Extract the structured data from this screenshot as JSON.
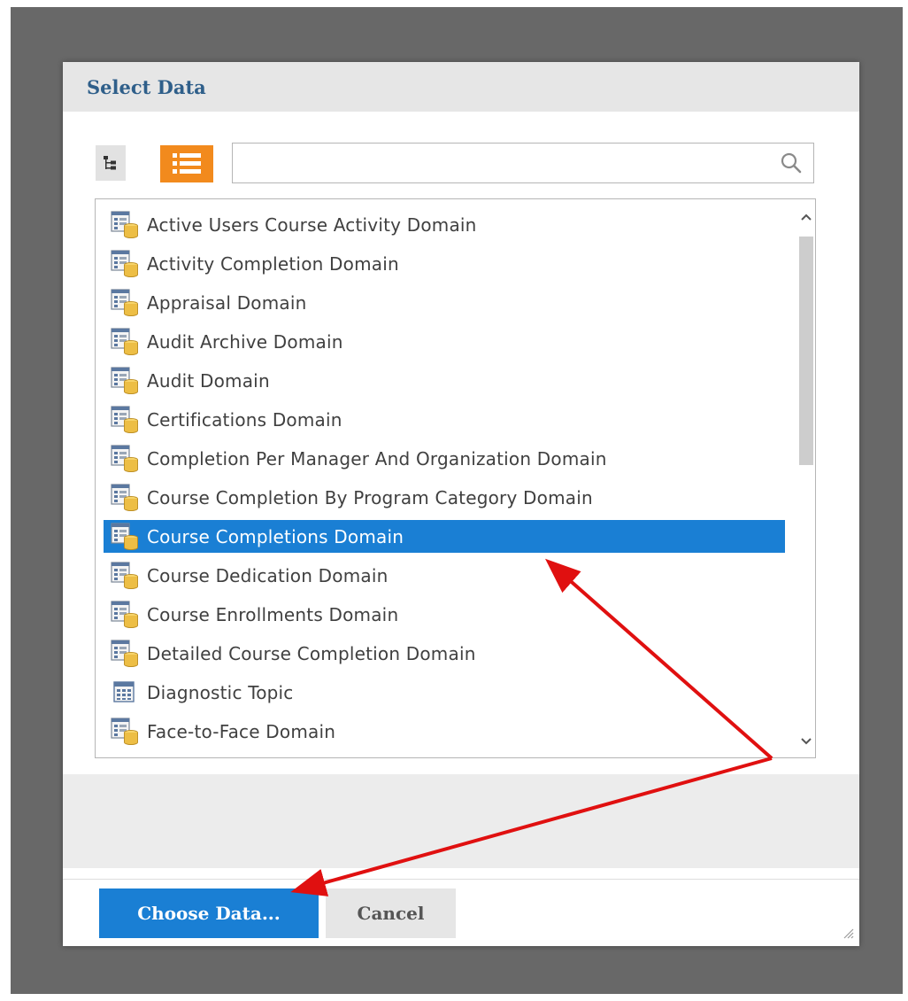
{
  "dialog": {
    "title": "Select Data"
  },
  "toolbar": {
    "tree_view_icon": "tree-view-icon",
    "list_view_icon": "list-view-icon",
    "search_placeholder": "",
    "search_value": "",
    "search_icon": "search-icon"
  },
  "list": {
    "items": [
      {
        "label": "Active Users Course Activity Domain",
        "icon": "domain-icon",
        "selected": false
      },
      {
        "label": "Activity Completion Domain",
        "icon": "domain-icon",
        "selected": false
      },
      {
        "label": "Appraisal Domain",
        "icon": "domain-icon",
        "selected": false
      },
      {
        "label": "Audit Archive Domain",
        "icon": "domain-icon",
        "selected": false
      },
      {
        "label": "Audit Domain",
        "icon": "domain-icon",
        "selected": false
      },
      {
        "label": "Certifications Domain",
        "icon": "domain-icon",
        "selected": false
      },
      {
        "label": "Completion Per Manager And Organization Domain",
        "icon": "domain-icon",
        "selected": false
      },
      {
        "label": "Course Completion By Program Category Domain",
        "icon": "domain-icon",
        "selected": false
      },
      {
        "label": "Course Completions Domain",
        "icon": "domain-icon",
        "selected": true
      },
      {
        "label": "Course Dedication Domain",
        "icon": "domain-icon",
        "selected": false
      },
      {
        "label": "Course Enrollments Domain",
        "icon": "domain-icon",
        "selected": false
      },
      {
        "label": "Detailed Course Completion Domain",
        "icon": "domain-icon",
        "selected": false
      },
      {
        "label": "Diagnostic Topic",
        "icon": "topic-icon",
        "selected": false
      },
      {
        "label": "Face-to-Face Domain",
        "icon": "domain-icon",
        "selected": false
      }
    ]
  },
  "buttons": {
    "choose_label": "Choose Data...",
    "cancel_label": "Cancel"
  },
  "colors": {
    "accent": "#1a7fd4",
    "list_view_active": "#f28a1d",
    "annotation_arrow": "#e01010",
    "title": "#2f5f8a"
  }
}
